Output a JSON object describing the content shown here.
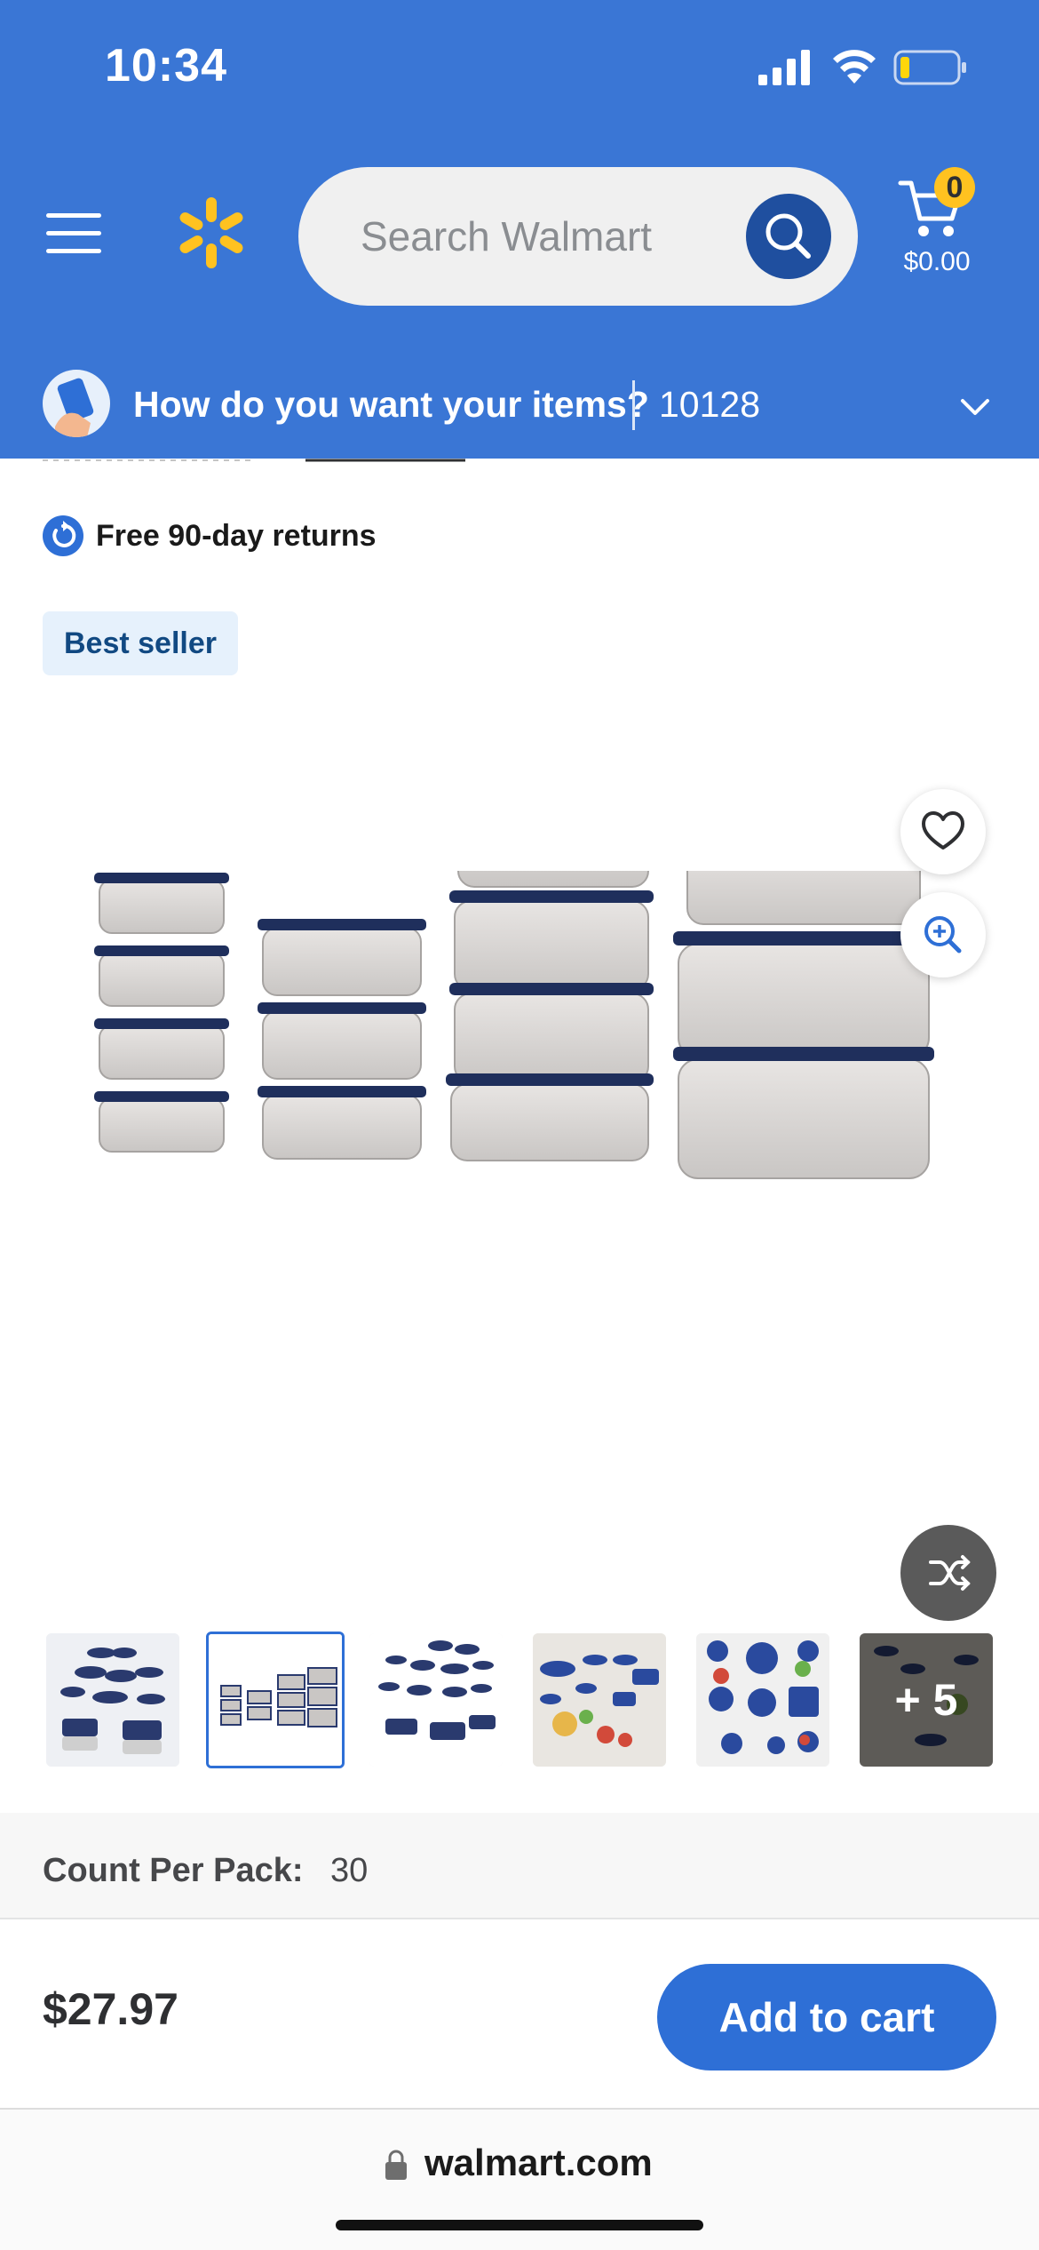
{
  "status_bar": {
    "time": "10:34"
  },
  "header": {
    "search": {
      "placeholder": "Search Walmart"
    },
    "cart": {
      "count": "0",
      "amount": "$0.00"
    },
    "fulfillment": {
      "question": "How do you want your items?",
      "zip": "10128"
    },
    "colors": {
      "background": "#3a76d5",
      "spark": "#ffc220",
      "search_button": "#1f4f9f"
    }
  },
  "product": {
    "returns_text": "Free 90-day returns",
    "badge": "Best seller",
    "thumbnails": [
      {
        "name": "thumb-1"
      },
      {
        "name": "thumb-2",
        "selected": true
      },
      {
        "name": "thumb-3"
      },
      {
        "name": "thumb-4"
      },
      {
        "name": "thumb-5"
      },
      {
        "name": "thumb-6",
        "more": "+ 5"
      }
    ],
    "variant": {
      "label": "Count Per Pack:",
      "value": "30"
    }
  },
  "buy_bar": {
    "price": "$27.97",
    "add_to_cart": "Add to cart"
  },
  "browser": {
    "url": "walmart.com"
  }
}
